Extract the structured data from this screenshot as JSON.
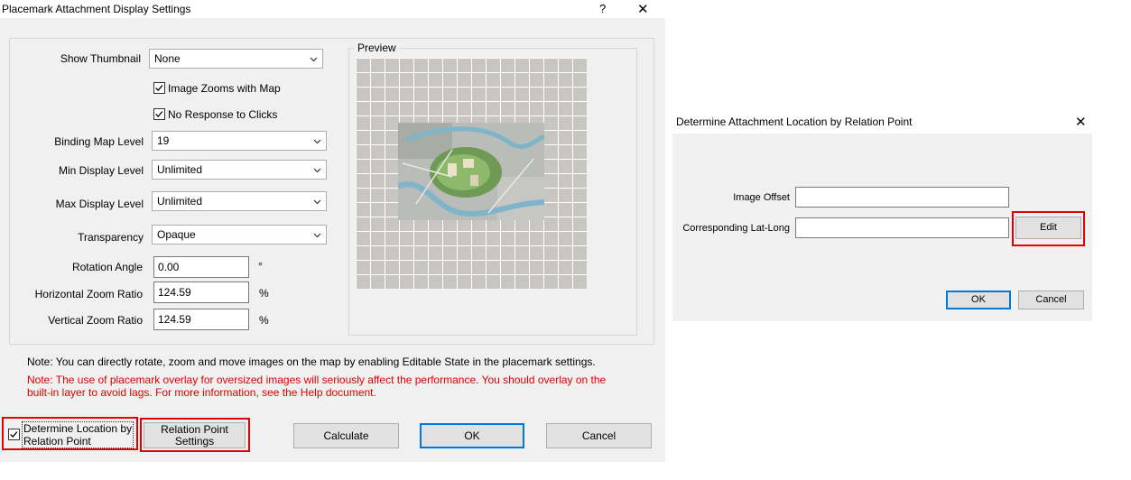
{
  "dialog1": {
    "title": "Placemark Attachment Display Settings",
    "help_label": "?",
    "close_label": "✕",
    "show_thumbnail": {
      "label": "Show Thumbnail",
      "value": "None"
    },
    "image_zooms": {
      "label": "Image Zooms with Map",
      "checked": true
    },
    "no_response": {
      "label": "No Response to Clicks",
      "checked": true
    },
    "binding_map_level": {
      "label": "Binding Map Level",
      "value": "19"
    },
    "min_display_level": {
      "label": "Min Display Level",
      "value": "Unlimited"
    },
    "max_display_level": {
      "label": "Max Display Level",
      "value": "Unlimited"
    },
    "transparency": {
      "label": "Transparency",
      "value": "Opaque"
    },
    "rotation_angle": {
      "label": "Rotation Angle",
      "value": "0.00",
      "unit": "°"
    },
    "horizontal_zoom": {
      "label": "Horizontal Zoom Ratio",
      "value": "124.59",
      "unit": "%"
    },
    "vertical_zoom": {
      "label": "Vertical Zoom Ratio",
      "value": "124.59",
      "unit": "%"
    },
    "preview_label": "Preview",
    "note1": "Note: You can directly rotate, zoom and move images on the map by enabling Editable State in the placemark settings.",
    "note2_line1": "Note: The use of placemark overlay for oversized images will seriously affect the performance. You should overlay on the",
    "note2_line2": "built-in layer to avoid lags. For more information, see the Help document.",
    "determine_location": {
      "line1": "Determine Location by",
      "line2": "Relation Point",
      "checked": true
    },
    "relation_point_settings": {
      "line1": "Relation Point",
      "line2": "Settings"
    },
    "calculate": "Calculate",
    "ok": "OK",
    "cancel": "Cancel"
  },
  "dialog2": {
    "title": "Determine Attachment Location by Relation Point",
    "close_label": "✕",
    "image_offset": {
      "label": "Image Offset",
      "value": ""
    },
    "lat_long": {
      "label": "Corresponding Lat-Long",
      "value": ""
    },
    "edit": "Edit",
    "ok": "OK",
    "cancel": "Cancel"
  },
  "colors": {
    "highlight": "#e00000",
    "accent": "#0078d7",
    "note": "#e00000"
  }
}
